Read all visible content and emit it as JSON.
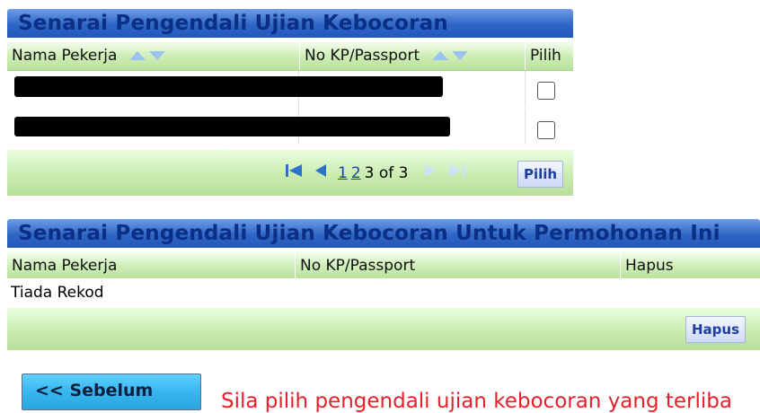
{
  "panel1": {
    "title": "Senarai Pengendali Ujian Kebocoran",
    "columns": [
      "Nama Pekerja",
      "No KP/Passport",
      "Pilih"
    ],
    "rows": [
      {
        "checked": false
      },
      {
        "checked": false
      }
    ],
    "pager": {
      "page1": "1",
      "page2": "2",
      "summary": "3 of 3"
    },
    "select_button": "Pilih"
  },
  "panel2": {
    "title": "Senarai Pengendali Ujian Kebocoran Untuk Permohonan Ini",
    "columns": [
      "Nama Pekerja",
      "No KP/Passport",
      "Hapus"
    ],
    "empty_text": "Tiada Rekod",
    "delete_button": "Hapus"
  },
  "prev_button": "<< Sebelum",
  "warning": "Sila pilih pengendali ujian kebocoran yang terliba",
  "colors": {
    "title_bg": "#2f66c6",
    "header_green": "#cfeeb8",
    "warning": "#e8202a",
    "prev_button": "#36b6ee"
  }
}
